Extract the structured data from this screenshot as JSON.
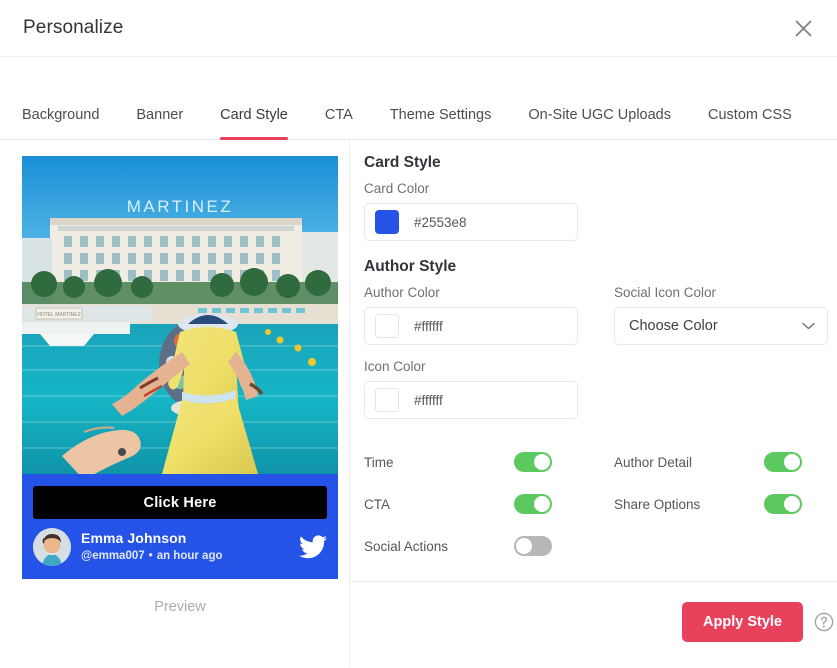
{
  "header": {
    "title": "Personalize",
    "close_icon": "close-icon"
  },
  "tabs": [
    {
      "label": "Background",
      "active": false
    },
    {
      "label": "Banner",
      "active": false
    },
    {
      "label": "Card Style",
      "active": true
    },
    {
      "label": "CTA",
      "active": false
    },
    {
      "label": "Theme Settings",
      "active": false
    },
    {
      "label": "On-Site UGC Uploads",
      "active": false
    },
    {
      "label": "Custom CSS",
      "active": false
    }
  ],
  "preview": {
    "caption": "Preview",
    "card_background": "#2553e8",
    "cta_label": "Click Here",
    "cta_background": "#000000",
    "author_name": "Emma Johnson",
    "author_handle": "@emma007",
    "separator": "•",
    "timestamp": "an hour ago",
    "social_icon": "twitter-icon",
    "photo_alt": "Hotel Martinez Cannes waterfront with woman in yellow dress",
    "photo_sign_text": "MARTINEZ",
    "photo_plaque_text": "HOTEL MARTINEZ"
  },
  "settings": {
    "card_style_title": "Card Style",
    "card_color_label": "Card Color",
    "card_color_value": "#2553e8",
    "author_style_title": "Author Style",
    "author_color_label": "Author Color",
    "author_color_value": "#ffffff",
    "social_icon_color_label": "Social Icon Color",
    "social_icon_color_value": "Choose Color",
    "icon_color_label": "Icon Color",
    "icon_color_value": "#ffffff",
    "toggles": [
      {
        "label": "Time",
        "on": true
      },
      {
        "label": "Author Detail",
        "on": true
      },
      {
        "label": "CTA",
        "on": true
      },
      {
        "label": "Share Options",
        "on": true
      },
      {
        "label": "Social Actions",
        "on": false
      }
    ]
  },
  "footer": {
    "apply_label": "Apply Style",
    "help_icon": "help-icon",
    "accent_color": "#e8415c",
    "toggle_on_color": "#5cc95f",
    "toggle_off_color": "#b6b7b9"
  }
}
